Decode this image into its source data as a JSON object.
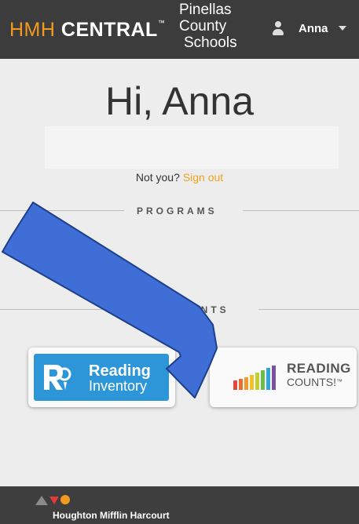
{
  "header": {
    "brand_prefix": "HMH",
    "brand_main": "CENTRAL",
    "brand_tm": "™",
    "district_line1": "Pinellas",
    "district_line2": "County",
    "district_line3": "Schools",
    "user_name": "Anna",
    "user_icon": "user-icon",
    "menu_icon": "caret-down-icon"
  },
  "main": {
    "greeting": "Hi, Anna",
    "not_you_text": "Not you?",
    "sign_out_label": "Sign out",
    "programs_label": "PROGRAMS",
    "assessments_label": "ASSESSMENTS"
  },
  "programs": [
    {
      "line1": "Reading",
      "line2": "Inventory"
    },
    {
      "line1": "READING",
      "line2": "COUNTS!",
      "mark": "™"
    }
  ],
  "footer": {
    "company": "Houghton Mifflin Harcourt"
  },
  "colors": {
    "accent_orange": "#f29a1f",
    "header_bg": "#3c3c3c",
    "arrow_blue": "#3f6fd6",
    "reading_inventory_blue": "#2d96d8"
  }
}
